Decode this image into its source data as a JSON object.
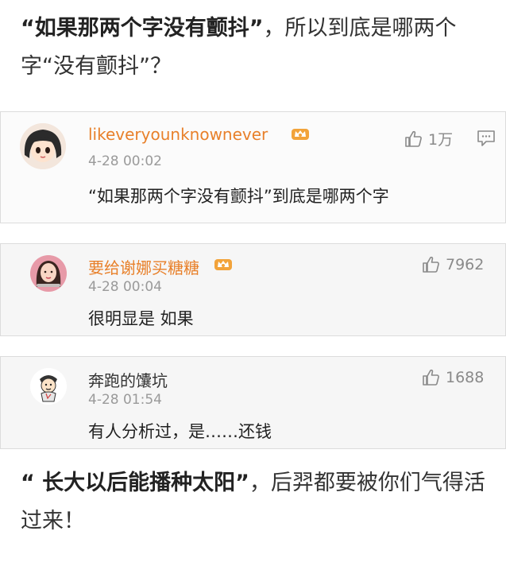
{
  "article": {
    "top_bold": "“如果那两个字没有颤抖”",
    "top_rest": "，所以到底是哪两个字“没有颤抖”？",
    "bottom_bold": "“ 长大以后能播种太阳”",
    "bottom_rest": "，后羿都要被你们气得活过来！"
  },
  "comments": [
    {
      "username": "likeveryounknownever",
      "time": "4-28 00:02",
      "content": "“如果那两个字没有颤抖”到底是哪两个字",
      "likes": "1万"
    },
    {
      "username": "要给谢娜买糖糖",
      "time": "4-28 00:04",
      "content": "很明显是 如果",
      "likes": "7962"
    },
    {
      "username": "奔跑的馕坑",
      "time": "4-28 01:54",
      "content": "有人分析过，是……还钱",
      "likes": "1688"
    }
  ],
  "colors": {
    "vip_username": "#e8802a",
    "timestamp": "#9a9a9a",
    "card_bg": "#f6f6f6"
  },
  "icons": {
    "like": "thumbs-up-icon",
    "reply": "comment-icon",
    "vip": "crown-badge-icon"
  }
}
